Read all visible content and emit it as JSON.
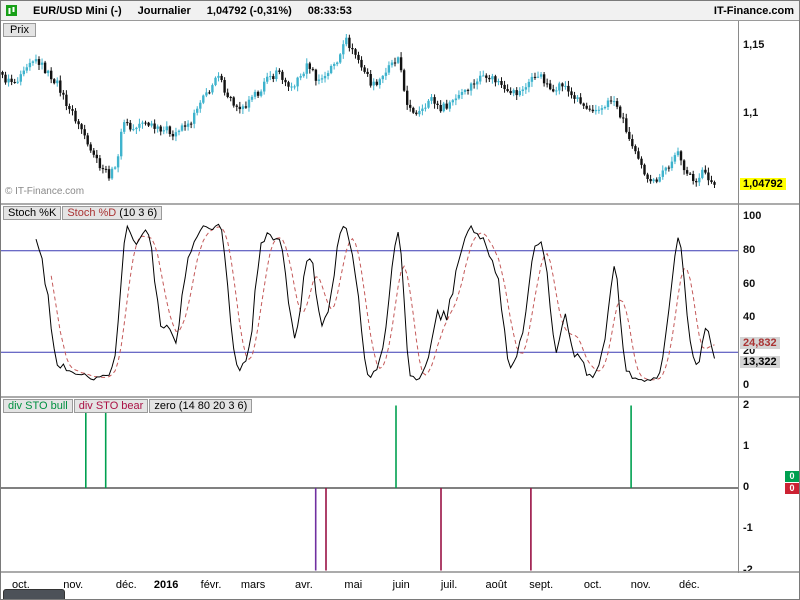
{
  "header": {
    "symbol": "EUR/USD Mini (-)",
    "timeframe": "Journalier",
    "price": "1,04792 (-0,31%)",
    "time": "08:33:53",
    "brand": "IT-Finance.com",
    "icon_color": "#18a018"
  },
  "price_panel": {
    "tab": "Prix",
    "watermark": "© IT-Finance.com",
    "price_badge": {
      "label": "1,04792",
      "value": 1.04792,
      "bg": "#ffff00",
      "text_color": "#000000"
    }
  },
  "stoch_panel": {
    "labels": [
      {
        "text": "Stoch %K",
        "color": "#000000"
      },
      {
        "text": "Stoch %D",
        "color": "#aa3333"
      },
      {
        "text": "(10 3 6)",
        "color": "#000000"
      }
    ],
    "badges": [
      {
        "label": "24,832",
        "value": 24.832,
        "text_color": "#aa3333",
        "bg": "#d4d4d4"
      },
      {
        "label": "13,322",
        "value": 13.322,
        "text_color": "#000000",
        "bg": "#d4d4d4"
      }
    ]
  },
  "div_panel": {
    "labels": [
      {
        "text": "div STO bull",
        "color": "#009040"
      },
      {
        "text": "div STO bear",
        "color": "#aa1144"
      },
      {
        "text": "zero",
        "color": "#000000"
      },
      {
        "text": "(14 80 20 3 6)",
        "color": "#000000"
      }
    ],
    "badges": [
      {
        "label": "0",
        "bg": "#00a050",
        "text_color": "#ffffff"
      },
      {
        "label": "0",
        "bg": "#cc2233",
        "text_color": "#ffffff"
      }
    ]
  },
  "x_axis": {
    "labels": [
      {
        "text": "oct.",
        "x": 0.027
      },
      {
        "text": "nov.",
        "x": 0.098
      },
      {
        "text": "déc.",
        "x": 0.17
      },
      {
        "text": "2016",
        "x": 0.224,
        "bold": true
      },
      {
        "text": "févr.",
        "x": 0.285
      },
      {
        "text": "mars",
        "x": 0.342
      },
      {
        "text": "avr.",
        "x": 0.411
      },
      {
        "text": "mai",
        "x": 0.478
      },
      {
        "text": "juin",
        "x": 0.543
      },
      {
        "text": "juil.",
        "x": 0.608
      },
      {
        "text": "août",
        "x": 0.672
      },
      {
        "text": "sept.",
        "x": 0.733
      },
      {
        "text": "oct.",
        "x": 0.803
      },
      {
        "text": "nov.",
        "x": 0.868
      },
      {
        "text": "déc.",
        "x": 0.934
      }
    ]
  },
  "chart_data": [
    {
      "type": "candlestick",
      "title": "EUR/USD Mini Journalier",
      "candle_count": 235,
      "up_color": "#3fb3cd",
      "down_color": "#111111",
      "ylim": [
        1.035,
        1.165
      ],
      "y_ticks": [
        {
          "label": "1,15",
          "value": 1.15
        },
        {
          "label": "1,1",
          "value": 1.1
        }
      ],
      "last_price": 1.04792,
      "price_path": [
        [
          0.0,
          1.127
        ],
        [
          0.018,
          1.121
        ],
        [
          0.035,
          1.133
        ],
        [
          0.048,
          1.14
        ],
        [
          0.062,
          1.131
        ],
        [
          0.075,
          1.124
        ],
        [
          0.09,
          1.108
        ],
        [
          0.105,
          1.094
        ],
        [
          0.12,
          1.08
        ],
        [
          0.135,
          1.064
        ],
        [
          0.152,
          1.054
        ],
        [
          0.163,
          1.071
        ],
        [
          0.17,
          1.097
        ],
        [
          0.182,
          1.088
        ],
        [
          0.2,
          1.094
        ],
        [
          0.218,
          1.091
        ],
        [
          0.24,
          1.086
        ],
        [
          0.262,
          1.092
        ],
        [
          0.285,
          1.114
        ],
        [
          0.303,
          1.127
        ],
        [
          0.318,
          1.113
        ],
        [
          0.333,
          1.101
        ],
        [
          0.35,
          1.11
        ],
        [
          0.37,
          1.124
        ],
        [
          0.388,
          1.132
        ],
        [
          0.402,
          1.117
        ],
        [
          0.418,
          1.127
        ],
        [
          0.43,
          1.137
        ],
        [
          0.443,
          1.124
        ],
        [
          0.457,
          1.131
        ],
        [
          0.47,
          1.139
        ],
        [
          0.48,
          1.156
        ],
        [
          0.492,
          1.147
        ],
        [
          0.505,
          1.135
        ],
        [
          0.52,
          1.121
        ],
        [
          0.533,
          1.128
        ],
        [
          0.545,
          1.135
        ],
        [
          0.556,
          1.14
        ],
        [
          0.566,
          1.112
        ],
        [
          0.576,
          1.098
        ],
        [
          0.588,
          1.105
        ],
        [
          0.602,
          1.111
        ],
        [
          0.616,
          1.104
        ],
        [
          0.63,
          1.109
        ],
        [
          0.645,
          1.117
        ],
        [
          0.66,
          1.122
        ],
        [
          0.678,
          1.13
        ],
        [
          0.695,
          1.124
        ],
        [
          0.71,
          1.119
        ],
        [
          0.724,
          1.114
        ],
        [
          0.738,
          1.123
        ],
        [
          0.752,
          1.13
        ],
        [
          0.768,
          1.118
        ],
        [
          0.785,
          1.122
        ],
        [
          0.8,
          1.114
        ],
        [
          0.815,
          1.106
        ],
        [
          0.83,
          1.099
        ],
        [
          0.848,
          1.108
        ],
        [
          0.858,
          1.11
        ],
        [
          0.872,
          1.094
        ],
        [
          0.886,
          1.073
        ],
        [
          0.9,
          1.058
        ],
        [
          0.915,
          1.05
        ],
        [
          0.928,
          1.059
        ],
        [
          0.94,
          1.063
        ],
        [
          0.95,
          1.073
        ],
        [
          0.96,
          1.057
        ],
        [
          0.972,
          1.05
        ],
        [
          0.982,
          1.058
        ],
        [
          0.992,
          1.052
        ],
        [
          1.0,
          1.048
        ]
      ]
    },
    {
      "type": "line",
      "name": "Stochastic",
      "params": "(10 3 6)",
      "k_period": 10,
      "k_smoothing": 3,
      "d_period": 6,
      "ylim": [
        0,
        100
      ],
      "y_ticks": [
        100,
        80,
        60,
        40,
        20,
        0
      ],
      "bands": [
        80,
        20
      ],
      "band_color": "#3a3ab4",
      "k_color": "#000000",
      "d_color": "#c45a5a",
      "last_values": {
        "k": 13.322,
        "d": 24.832
      }
    },
    {
      "type": "bar",
      "name": "div STO",
      "params": "(14 80 20 3 6)",
      "ylim": [
        -2,
        2
      ],
      "y_ticks": [
        2,
        1,
        0,
        -1,
        -2
      ],
      "zero_line": 0,
      "bull_color": "#00a050",
      "bear_color": "#991144",
      "bull_spikes": [
        {
          "x": 0.115,
          "v": 2
        },
        {
          "x": 0.142,
          "v": 2
        },
        {
          "x": 0.536,
          "v": 2
        },
        {
          "x": 0.855,
          "v": 2
        }
      ],
      "bear_spikes": [
        {
          "x": 0.427,
          "v": -2,
          "color": "#7030a0"
        },
        {
          "x": 0.441,
          "v": -2
        },
        {
          "x": 0.597,
          "v": -2
        },
        {
          "x": 0.719,
          "v": -2
        }
      ],
      "last_values": {
        "bull": 0,
        "bear": 0
      }
    }
  ]
}
